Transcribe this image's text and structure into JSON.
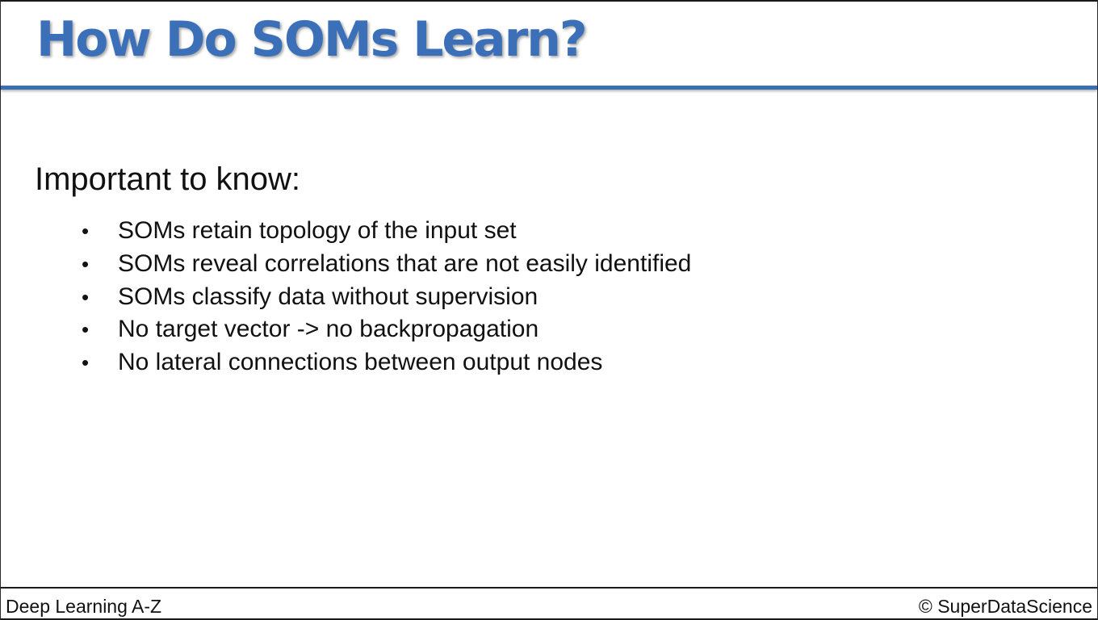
{
  "slide": {
    "title": "How Do SOMs Learn?",
    "heading": "Important to know:",
    "bullet_symbol": "•",
    "bullets": [
      "SOMs retain topology of the input set",
      "SOMs reveal correlations that are not easily identified",
      "SOMs classify data without supervision",
      "No target vector -> no backpropagation",
      "No lateral connections between output nodes"
    ]
  },
  "footer": {
    "course": "Deep Learning A-Z",
    "copyright": "© SuperDataScience"
  },
  "colors": {
    "title": "#3b70b9",
    "rule": "#3b6fb3",
    "text": "#111111"
  }
}
